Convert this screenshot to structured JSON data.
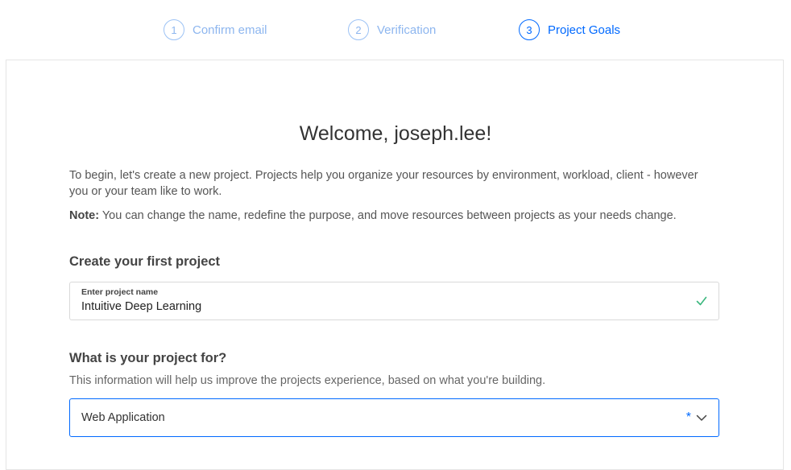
{
  "stepper": {
    "steps": [
      {
        "number": "1",
        "label": "Confirm email",
        "active": false
      },
      {
        "number": "2",
        "label": "Verification",
        "active": false
      },
      {
        "number": "3",
        "label": "Project Goals",
        "active": true
      }
    ]
  },
  "main": {
    "welcome": "Welcome, joseph.lee!",
    "intro": "To begin, let's create a new project. Projects help you organize your resources by environment, workload, client - however you or your team like to work.",
    "note_label": "Note:",
    "note_text": " You can change the name, redefine the purpose, and move resources between projects as your needs change.",
    "create_heading": "Create your first project",
    "name_field": {
      "label": "Enter project name",
      "value": "Intuitive Deep Learning"
    },
    "purpose_heading": "What is your project for?",
    "purpose_sub": "This information will help us improve the projects experience, based on what you're building.",
    "purpose_select": {
      "value": "Web Application",
      "required_mark": "*"
    }
  },
  "colors": {
    "accent": "#0069ff",
    "step_inactive": "#8db6ef",
    "valid_check": "#3bb77e"
  },
  "icons": {
    "check": "check-icon",
    "dropdown": "chevron-down-icon"
  }
}
